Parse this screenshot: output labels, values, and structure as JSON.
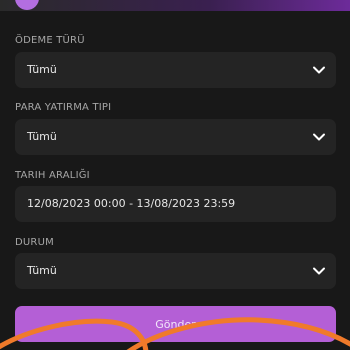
{
  "filters": {
    "payment_type": {
      "label": "ÖDEME TÜRÜ",
      "value": "Tümü",
      "icon": "chevron-down-icon"
    },
    "deposit_type": {
      "label": "PARA YATIRMA TIPI",
      "value": "Tümü",
      "icon": "chevron-down-icon"
    },
    "date_range": {
      "label": "TARIH ARALIĞI",
      "value": "12/08/2023 00:00 - 13/08/2023 23:59"
    },
    "status": {
      "label": "DURUM",
      "value": "Tümü",
      "icon": "chevron-down-icon"
    }
  },
  "submit": {
    "label": "Gönder"
  },
  "colors": {
    "background": "#181818",
    "field": "#242424",
    "accent": "#b45fd6",
    "annotation": "#f07a2a"
  }
}
